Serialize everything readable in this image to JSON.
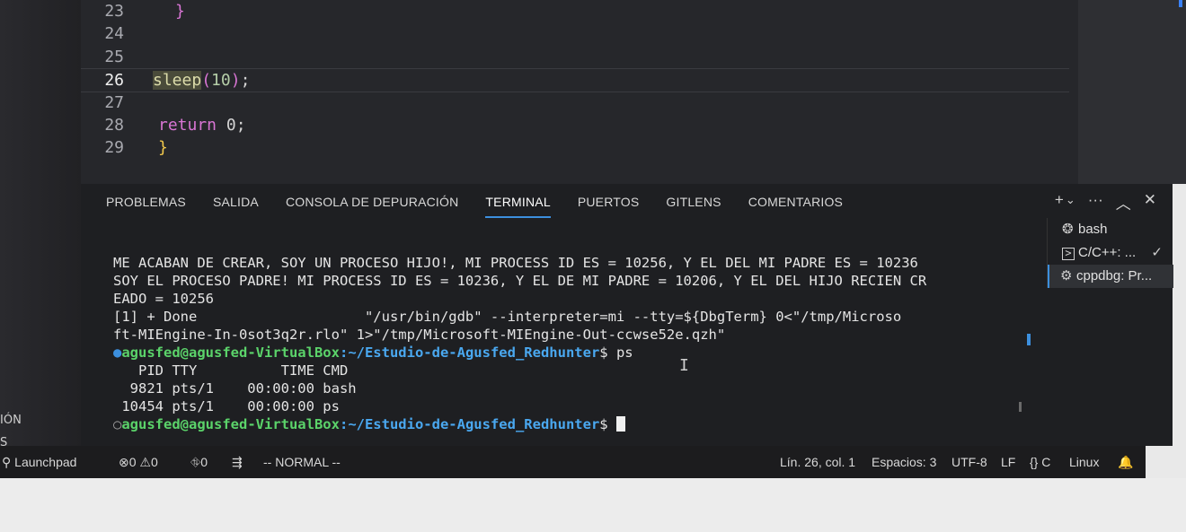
{
  "editor": {
    "lines": [
      {
        "num": "23",
        "code": "}",
        "kind": "brace-pink",
        "indent": "    "
      },
      {
        "num": "24",
        "code": "",
        "kind": "plain",
        "indent": ""
      },
      {
        "num": "25",
        "code": "",
        "kind": "plain",
        "indent": ""
      },
      {
        "num": "26",
        "fn": "sleep",
        "arg": "10",
        "suffix": ";",
        "kind": "call",
        "indent": ""
      },
      {
        "num": "27",
        "code": "",
        "kind": "plain",
        "indent": ""
      },
      {
        "num": "28",
        "kw": "return",
        "rest": "0;",
        "kind": "return",
        "indent": " "
      },
      {
        "num": "29",
        "code": "}",
        "kind": "brace",
        "indent": " "
      }
    ]
  },
  "panel": {
    "tabs": [
      "PROBLEMAS",
      "SALIDA",
      "CONSOLA DE DEPURACIÓN",
      "TERMINAL",
      "PUERTOS",
      "GITLENS",
      "COMENTARIOS"
    ],
    "active_tab": "TERMINAL",
    "actions": [
      "+",
      "⌄",
      "···",
      "︿",
      "✕"
    ]
  },
  "terminal": {
    "lines": [
      "ME ACABAN DE CREAR, SOY UN PROCESO HIJO!, MI PROCESS ID ES = 10256, Y EL DEL MI PADRE ES = 10236",
      "SOY EL PROCESO PADRE! MI PROCESS ID ES = 10236, Y EL DE MI PADRE = 10206, Y EL DEL HIJO RECIEN CR",
      "EADO = 10256",
      "[1] + Done                    \"/usr/bin/gdb\" --interpreter=mi --tty=${DbgTerm} 0<\"/tmp/Microso",
      "ft-MIEngine-In-0sot3q2r.rlo\" 1>\"/tmp/Microsoft-MIEngine-Out-ccwse52e.qzh\""
    ],
    "prompt_user": "agusfed@agusfed-VirtualBox",
    "prompt_path": ":~/Estudio-de-Agusfed_Redhunter",
    "prompt_symbol": "$ ",
    "command": "ps",
    "ps_output": [
      "   PID TTY          TIME CMD",
      "  9821 pts/1    00:00:00 bash",
      " 10454 pts/1    00:00:00 ps"
    ]
  },
  "terminal_list": [
    {
      "icon": "bash-icon",
      "label": "bash"
    },
    {
      "icon": "terminal-icon",
      "label": "C/C++: ...",
      "check": "✓"
    },
    {
      "icon": "debug-icon",
      "label": "cppdbg: Pr..."
    }
  ],
  "sidebar_partial": [
    "IÓN",
    "S"
  ],
  "status": {
    "launchpad": "Launchpad",
    "errors": "0",
    "warnings": "0",
    "ports": "0",
    "mode": "-- NORMAL --",
    "position": "Lín. 26, col. 1",
    "spaces": "Espacios: 3",
    "encoding": "UTF-8",
    "eol": "LF",
    "language": "{} C",
    "os": "Linux"
  }
}
